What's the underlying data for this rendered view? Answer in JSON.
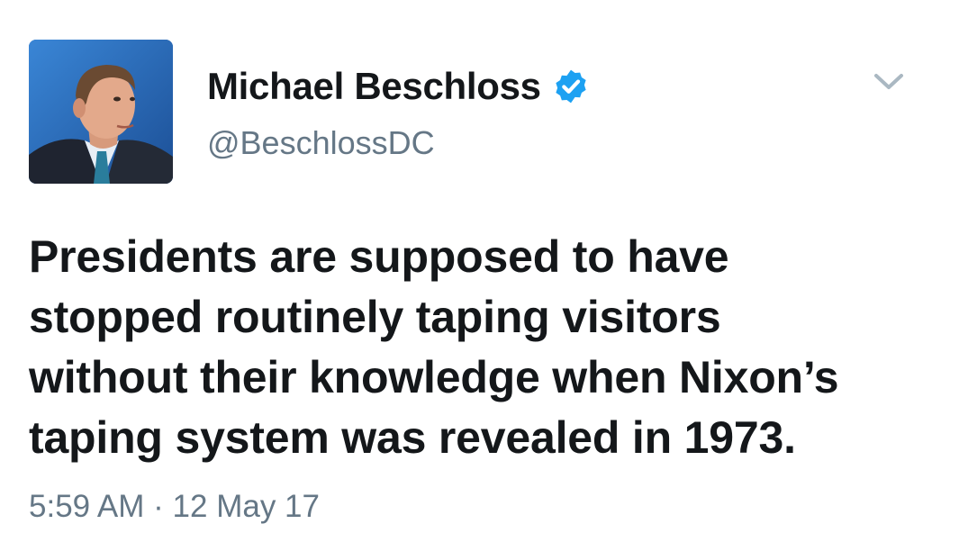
{
  "user": {
    "display_name": "Michael Beschloss",
    "handle": "@BeschlossDC",
    "verified_icon": "verified-badge-icon",
    "avatar_icon": "avatar-photo"
  },
  "tweet": {
    "lines": [
      "Presidents are supposed to have",
      "stopped routinely taping visitors",
      "without their knowledge when Nixon’s",
      "taping system was revealed in 1973."
    ],
    "time": "5:59 AM",
    "separator": "·",
    "date": "12 May 17"
  },
  "menu": {
    "icon": "chevron-down-icon"
  },
  "colors": {
    "text": "#14171a",
    "secondary": "#657786",
    "verified": "#1da1f2",
    "chevron": "#aab8c2"
  }
}
